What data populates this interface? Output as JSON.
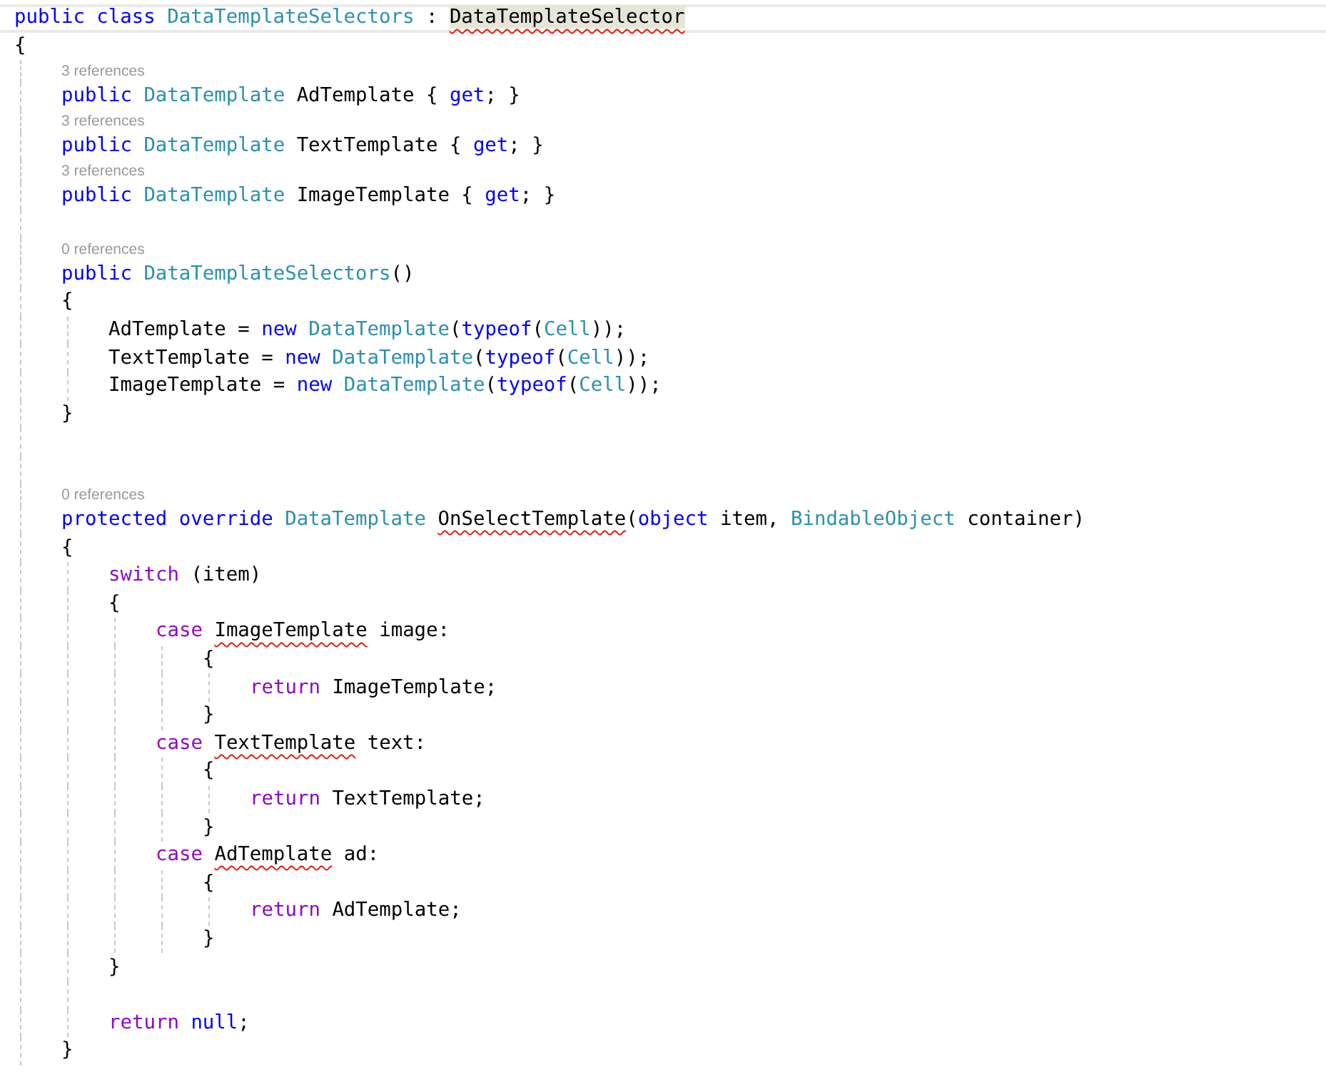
{
  "editor": {
    "lines": [
      {
        "kind": "code",
        "current": true,
        "tokens": [
          {
            "t": "public class ",
            "kind": "keyword"
          },
          {
            "t": "DataTemplateSelectors",
            "kind": "type"
          },
          {
            "t": " : ",
            "kind": "plain"
          },
          {
            "t": "DataTemplateSelector",
            "kind": "plain",
            "error": true,
            "highlighted": true
          }
        ]
      },
      {
        "kind": "code",
        "current": false,
        "tokens": [
          {
            "t": "{",
            "kind": "plain"
          }
        ],
        "children": [
          {
            "kind": "lens",
            "text": "3 references"
          },
          {
            "kind": "code",
            "current": false,
            "tokens": [
              {
                "t": "public ",
                "kind": "keyword"
              },
              {
                "t": "DataTemplate",
                "kind": "type"
              },
              {
                "t": " AdTemplate { ",
                "kind": "plain"
              },
              {
                "t": "get",
                "kind": "keyword"
              },
              {
                "t": "; }",
                "kind": "plain"
              }
            ]
          },
          {
            "kind": "lens",
            "text": "3 references"
          },
          {
            "kind": "code",
            "current": false,
            "tokens": [
              {
                "t": "public ",
                "kind": "keyword"
              },
              {
                "t": "DataTemplate",
                "kind": "type"
              },
              {
                "t": " TextTemplate { ",
                "kind": "plain"
              },
              {
                "t": "get",
                "kind": "keyword"
              },
              {
                "t": "; }",
                "kind": "plain"
              }
            ]
          },
          {
            "kind": "lens",
            "text": "3 references"
          },
          {
            "kind": "code",
            "current": false,
            "tokens": [
              {
                "t": "public ",
                "kind": "keyword"
              },
              {
                "t": "DataTemplate",
                "kind": "type"
              },
              {
                "t": " ImageTemplate { ",
                "kind": "plain"
              },
              {
                "t": "get",
                "kind": "keyword"
              },
              {
                "t": "; }",
                "kind": "plain"
              }
            ]
          },
          {
            "kind": "blank"
          },
          {
            "kind": "lens",
            "text": "0 references"
          },
          {
            "kind": "code",
            "current": false,
            "tokens": [
              {
                "t": "public ",
                "kind": "keyword"
              },
              {
                "t": "DataTemplateSelectors",
                "kind": "type"
              },
              {
                "t": "()",
                "kind": "plain"
              }
            ]
          },
          {
            "kind": "code",
            "current": false,
            "tokens": [
              {
                "t": "{",
                "kind": "plain"
              }
            ],
            "children": [
              {
                "kind": "code",
                "current": false,
                "tokens": [
                  {
                    "t": "AdTemplate = ",
                    "kind": "plain"
                  },
                  {
                    "t": "new ",
                    "kind": "keyword"
                  },
                  {
                    "t": "DataTemplate",
                    "kind": "type"
                  },
                  {
                    "t": "(",
                    "kind": "plain"
                  },
                  {
                    "t": "typeof",
                    "kind": "keyword"
                  },
                  {
                    "t": "(",
                    "kind": "plain"
                  },
                  {
                    "t": "Cell",
                    "kind": "type"
                  },
                  {
                    "t": "));",
                    "kind": "plain"
                  }
                ]
              },
              {
                "kind": "code",
                "current": false,
                "tokens": [
                  {
                    "t": "TextTemplate = ",
                    "kind": "plain"
                  },
                  {
                    "t": "new ",
                    "kind": "keyword"
                  },
                  {
                    "t": "DataTemplate",
                    "kind": "type"
                  },
                  {
                    "t": "(",
                    "kind": "plain"
                  },
                  {
                    "t": "typeof",
                    "kind": "keyword"
                  },
                  {
                    "t": "(",
                    "kind": "plain"
                  },
                  {
                    "t": "Cell",
                    "kind": "type"
                  },
                  {
                    "t": "));",
                    "kind": "plain"
                  }
                ]
              },
              {
                "kind": "code",
                "current": false,
                "tokens": [
                  {
                    "t": "ImageTemplate = ",
                    "kind": "plain"
                  },
                  {
                    "t": "new ",
                    "kind": "keyword"
                  },
                  {
                    "t": "DataTemplate",
                    "kind": "type"
                  },
                  {
                    "t": "(",
                    "kind": "plain"
                  },
                  {
                    "t": "typeof",
                    "kind": "keyword"
                  },
                  {
                    "t": "(",
                    "kind": "plain"
                  },
                  {
                    "t": "Cell",
                    "kind": "type"
                  },
                  {
                    "t": "));",
                    "kind": "plain"
                  }
                ]
              }
            ]
          },
          {
            "kind": "code",
            "current": false,
            "tokens": [
              {
                "t": "}",
                "kind": "plain"
              }
            ]
          },
          {
            "kind": "blank"
          },
          {
            "kind": "blank"
          },
          {
            "kind": "lens",
            "text": "0 references"
          },
          {
            "kind": "code",
            "current": false,
            "tokens": [
              {
                "t": "protected override ",
                "kind": "keyword"
              },
              {
                "t": "DataTemplate ",
                "kind": "type"
              },
              {
                "t": "OnSelectTemplate",
                "kind": "plain",
                "error": true
              },
              {
                "t": "(",
                "kind": "plain"
              },
              {
                "t": "object",
                "kind": "keyword"
              },
              {
                "t": " item, ",
                "kind": "plain"
              },
              {
                "t": "BindableObject",
                "kind": "type"
              },
              {
                "t": " container)",
                "kind": "plain"
              }
            ]
          },
          {
            "kind": "code",
            "current": false,
            "tokens": [
              {
                "t": "{",
                "kind": "plain"
              }
            ],
            "children": [
              {
                "kind": "code",
                "current": false,
                "tokens": [
                  {
                    "t": "switch",
                    "kind": "control"
                  },
                  {
                    "t": " (item)",
                    "kind": "plain"
                  }
                ]
              },
              {
                "kind": "code",
                "current": false,
                "tokens": [
                  {
                    "t": "{",
                    "kind": "plain"
                  }
                ],
                "children": [
                  {
                    "kind": "code",
                    "current": false,
                    "tokens": [
                      {
                        "t": "case ",
                        "kind": "control"
                      },
                      {
                        "t": "ImageTemplate",
                        "kind": "plain",
                        "error": true
                      },
                      {
                        "t": " image:",
                        "kind": "plain"
                      }
                    ],
                    "children": [
                      {
                        "kind": "code",
                        "current": false,
                        "tokens": [
                          {
                            "t": "{",
                            "kind": "plain"
                          }
                        ],
                        "children": [
                          {
                            "kind": "code",
                            "current": false,
                            "tokens": [
                              {
                                "t": "return",
                                "kind": "control"
                              },
                              {
                                "t": " ImageTemplate;",
                                "kind": "plain"
                              }
                            ]
                          }
                        ]
                      },
                      {
                        "kind": "code",
                        "current": false,
                        "tokens": [
                          {
                            "t": "}",
                            "kind": "plain"
                          }
                        ]
                      }
                    ]
                  },
                  {
                    "kind": "code",
                    "current": false,
                    "tokens": [
                      {
                        "t": "case ",
                        "kind": "control"
                      },
                      {
                        "t": "TextTemplate",
                        "kind": "plain",
                        "error": true
                      },
                      {
                        "t": " text:",
                        "kind": "plain"
                      }
                    ],
                    "children": [
                      {
                        "kind": "code",
                        "current": false,
                        "tokens": [
                          {
                            "t": "{",
                            "kind": "plain"
                          }
                        ],
                        "children": [
                          {
                            "kind": "code",
                            "current": false,
                            "tokens": [
                              {
                                "t": "return",
                                "kind": "control"
                              },
                              {
                                "t": " TextTemplate;",
                                "kind": "plain"
                              }
                            ]
                          }
                        ]
                      },
                      {
                        "kind": "code",
                        "current": false,
                        "tokens": [
                          {
                            "t": "}",
                            "kind": "plain"
                          }
                        ]
                      }
                    ]
                  },
                  {
                    "kind": "code",
                    "current": false,
                    "tokens": [
                      {
                        "t": "case ",
                        "kind": "control"
                      },
                      {
                        "t": "AdTemplate",
                        "kind": "plain",
                        "error": true
                      },
                      {
                        "t": " ad:",
                        "kind": "plain"
                      }
                    ],
                    "children": [
                      {
                        "kind": "code",
                        "current": false,
                        "tokens": [
                          {
                            "t": "{",
                            "kind": "plain"
                          }
                        ],
                        "children": [
                          {
                            "kind": "code",
                            "current": false,
                            "tokens": [
                              {
                                "t": "return",
                                "kind": "control"
                              },
                              {
                                "t": " AdTemplate;",
                                "kind": "plain"
                              }
                            ]
                          }
                        ]
                      },
                      {
                        "kind": "code",
                        "current": false,
                        "tokens": [
                          {
                            "t": "}",
                            "kind": "plain"
                          }
                        ]
                      }
                    ]
                  }
                ]
              },
              {
                "kind": "code",
                "current": false,
                "tokens": [
                  {
                    "t": "}",
                    "kind": "plain"
                  }
                ]
              },
              {
                "kind": "blank"
              },
              {
                "kind": "code",
                "current": false,
                "tokens": [
                  {
                    "t": "return ",
                    "kind": "control"
                  },
                  {
                    "t": "null",
                    "kind": "keyword"
                  },
                  {
                    "t": ";",
                    "kind": "plain"
                  }
                ]
              }
            ]
          },
          {
            "kind": "code",
            "current": false,
            "tokens": [
              {
                "t": "}",
                "kind": "plain"
              }
            ]
          }
        ]
      }
    ]
  }
}
